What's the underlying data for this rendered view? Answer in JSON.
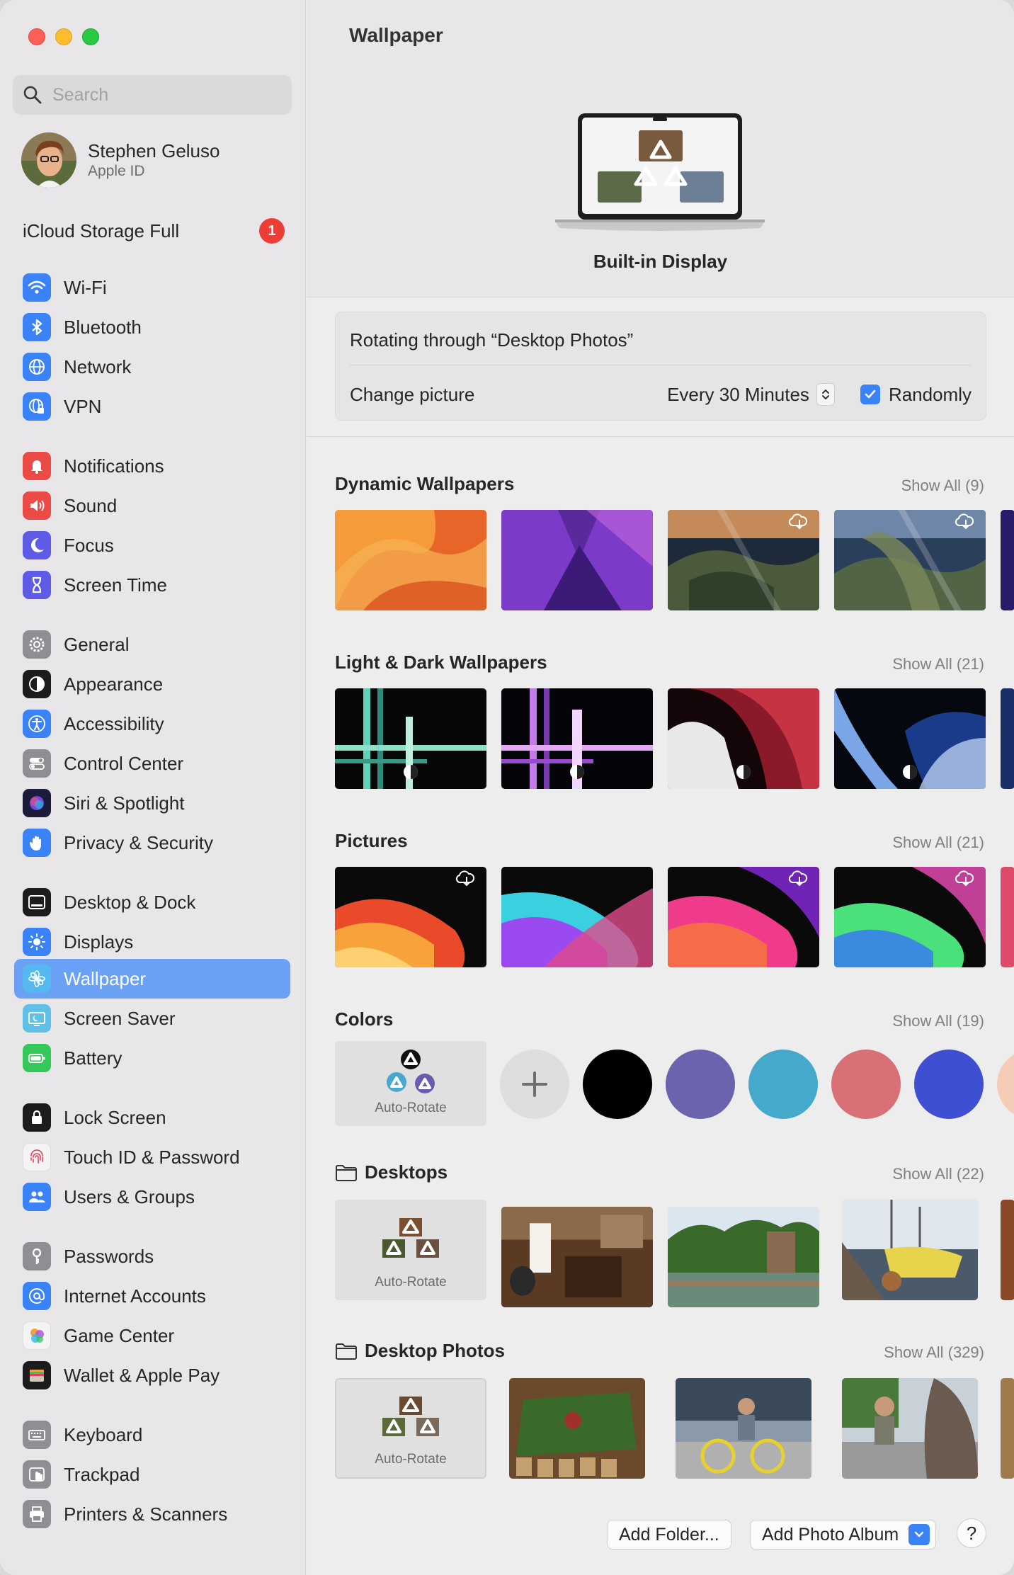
{
  "sidebar": {
    "search_placeholder": "Search",
    "profile": {
      "name": "Stephen Geluso",
      "subtitle": "Apple ID"
    },
    "icloud": {
      "label": "iCloud Storage Full",
      "badge": "1"
    },
    "items": [
      {
        "label": "Wi-Fi",
        "icon": "wifi-icon"
      },
      {
        "label": "Bluetooth",
        "icon": "bluetooth-icon"
      },
      {
        "label": "Network",
        "icon": "globe-icon"
      },
      {
        "label": "VPN",
        "icon": "vpn-globe-icon"
      },
      {
        "label": "Notifications",
        "icon": "bell-icon"
      },
      {
        "label": "Sound",
        "icon": "speaker-icon"
      },
      {
        "label": "Focus",
        "icon": "moon-icon"
      },
      {
        "label": "Screen Time",
        "icon": "hourglass-icon"
      },
      {
        "label": "General",
        "icon": "gear-icon"
      },
      {
        "label": "Appearance",
        "icon": "appearance-icon"
      },
      {
        "label": "Accessibility",
        "icon": "accessibility-icon"
      },
      {
        "label": "Control Center",
        "icon": "toggles-icon"
      },
      {
        "label": "Siri & Spotlight",
        "icon": "siri-icon"
      },
      {
        "label": "Privacy & Security",
        "icon": "hand-icon"
      },
      {
        "label": "Desktop & Dock",
        "icon": "dock-icon"
      },
      {
        "label": "Displays",
        "icon": "sun-icon"
      },
      {
        "label": "Wallpaper",
        "icon": "flower-icon"
      },
      {
        "label": "Screen Saver",
        "icon": "screensaver-icon"
      },
      {
        "label": "Battery",
        "icon": "battery-icon"
      },
      {
        "label": "Lock Screen",
        "icon": "lock-icon"
      },
      {
        "label": "Touch ID & Password",
        "icon": "fingerprint-icon"
      },
      {
        "label": "Users & Groups",
        "icon": "users-icon"
      },
      {
        "label": "Passwords",
        "icon": "key-icon"
      },
      {
        "label": "Internet Accounts",
        "icon": "at-icon"
      },
      {
        "label": "Game Center",
        "icon": "game-center-icon"
      },
      {
        "label": "Wallet & Apple Pay",
        "icon": "wallet-icon"
      },
      {
        "label": "Keyboard",
        "icon": "keyboard-icon"
      },
      {
        "label": "Trackpad",
        "icon": "trackpad-icon"
      },
      {
        "label": "Printers & Scanners",
        "icon": "printer-icon"
      }
    ],
    "selected": "Wallpaper"
  },
  "main": {
    "title": "Wallpaper",
    "display_name": "Built-in Display",
    "rotating_text": "Rotating through “Desktop Photos”",
    "change_picture_label": "Change picture",
    "interval": "Every 30 Minutes",
    "randomly_label": "Randomly",
    "randomly_checked": true,
    "sections": {
      "dynamic": {
        "title": "Dynamic Wallpapers",
        "show_all": "Show All (9)"
      },
      "light_dark": {
        "title": "Light & Dark Wallpapers",
        "show_all": "Show All (21)"
      },
      "pictures": {
        "title": "Pictures",
        "show_all": "Show All (21)"
      },
      "colors": {
        "title": "Colors",
        "show_all": "Show All (19)",
        "auto_rotate": "Auto-Rotate"
      },
      "desktops": {
        "title": "Desktops",
        "show_all": "Show All (22)",
        "auto_rotate": "Auto-Rotate"
      },
      "desktop_photos": {
        "title": "Desktop Photos",
        "show_all": "Show All (329)",
        "auto_rotate": "Auto-Rotate"
      }
    },
    "colors": [
      "#000000",
      "#6b63ad",
      "#45a9cc",
      "#d96f77",
      "#3f4fd1"
    ],
    "footer": {
      "add_folder": "Add Folder...",
      "add_album": "Add Photo Album",
      "help": "?"
    }
  }
}
